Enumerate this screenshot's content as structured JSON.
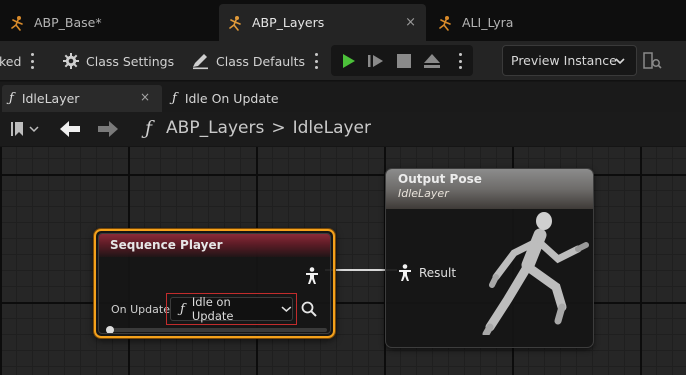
{
  "asset_tabs": [
    {
      "label": "ABP_Base*",
      "active": false
    },
    {
      "label": "ABP_Layers",
      "active": true,
      "close": "×"
    },
    {
      "label": "ALI_Lyra",
      "active": false
    }
  ],
  "toolbar": {
    "partial_label": "ked",
    "class_settings": "Class Settings",
    "class_defaults": "Class Defaults",
    "preview_instance": "Preview Instance"
  },
  "graph_tabs": [
    {
      "label": "IdleLayer",
      "active": true,
      "close": "×"
    },
    {
      "label": "Idle On Update",
      "active": false
    }
  ],
  "breadcrumb": {
    "graph": "ABP_Layers",
    "separator": ">",
    "function": "IdleLayer"
  },
  "nodes": {
    "sequence_player": {
      "title": "Sequence Player",
      "pin_label": "On Update",
      "function_value": "Idle on Update",
      "header_color": "#8a2a38",
      "selected_border": "#f4a11c"
    },
    "output_pose": {
      "title": "Output Pose",
      "subtitle": "IdleLayer",
      "pin_label": "Result"
    }
  },
  "colors": {
    "play_green": "#4cc13a",
    "accent_orange": "#e08a1a",
    "error_red": "#c22c2c"
  }
}
